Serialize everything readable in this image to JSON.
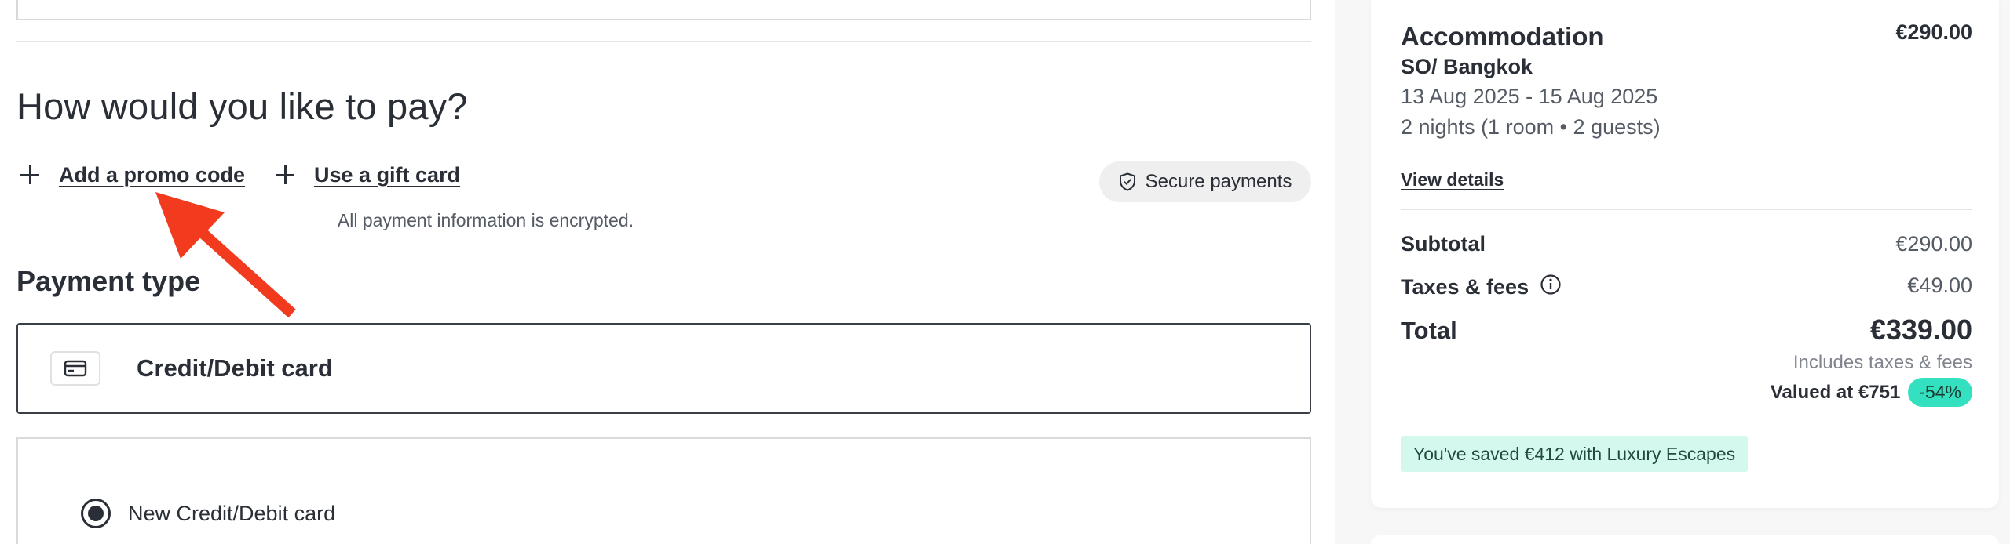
{
  "payment": {
    "heading": "How would you like to pay?",
    "promo_link": "Add a promo code",
    "gift_link": "Use a gift card",
    "secure_label": "Secure payments",
    "encrypted_note": "All payment information is encrypted.",
    "payment_type_heading": "Payment type",
    "card_option_label": "Credit/Debit card",
    "new_card_label": "New Credit/Debit card",
    "new_card_selected": true
  },
  "summary": {
    "section_title": "Accommodation",
    "section_price": "€290.00",
    "hotel_name": "SO/ Bangkok",
    "dates": "13 Aug 2025 - 15 Aug 2025",
    "nights_info": "2 nights (1 room • 2 guests)",
    "view_details": "View details",
    "subtotal_label": "Subtotal",
    "subtotal_value": "€290.00",
    "taxes_label": "Taxes & fees",
    "taxes_value": "€49.00",
    "total_label": "Total",
    "total_value": "€339.00",
    "includes_note": "Includes taxes & fees",
    "valued_at": "Valued at €751",
    "discount_badge": "-54%",
    "saved_banner": "You've saved €412 with Luxury Escapes"
  },
  "colors": {
    "accent_teal": "#33e0bf",
    "saved_bg": "#d4f7ee",
    "annotation_arrow": "#f23a1f"
  },
  "icons": [
    "plus-icon",
    "shield-check-icon",
    "credit-card-icon",
    "info-icon",
    "radio-selected-icon",
    "arrow-annotation"
  ]
}
